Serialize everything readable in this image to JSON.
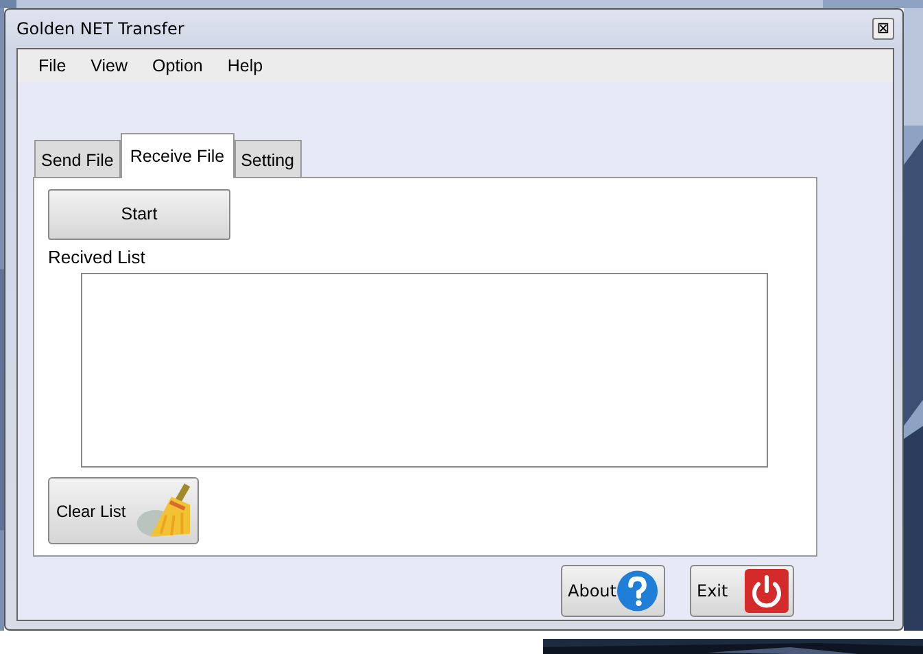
{
  "window": {
    "title": "Golden NET Transfer",
    "close": "⊠"
  },
  "menu": [
    {
      "label": "File"
    },
    {
      "label": "View"
    },
    {
      "label": "Option"
    },
    {
      "label": "Help"
    }
  ],
  "tabs": [
    {
      "label": "Send File",
      "selected": false
    },
    {
      "label": "Receive File",
      "selected": true
    },
    {
      "label": "Setting",
      "selected": false
    }
  ],
  "start_button": "Start",
  "list_label": "Recived List",
  "clear_button": "Clear List",
  "buttons": [
    {
      "label": "About",
      "kind": "about"
    },
    {
      "label": "Exit",
      "kind": "exit"
    }
  ]
}
